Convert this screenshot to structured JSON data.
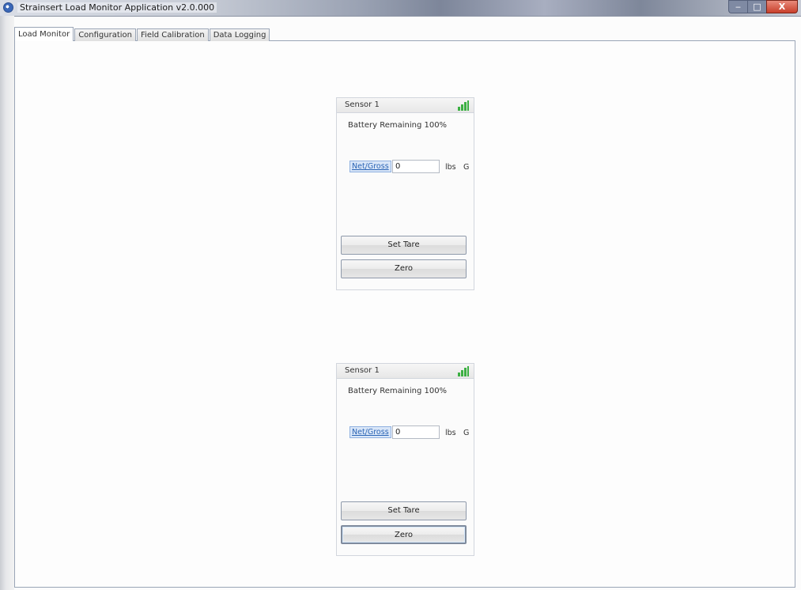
{
  "window": {
    "title": "Strainsert Load Monitor Application v2.0.000",
    "controls": {
      "minimize": "‒",
      "maximize": "□",
      "close": "X"
    }
  },
  "tabs": [
    {
      "label": "Load Monitor",
      "active": true
    },
    {
      "label": "Configuration",
      "active": false
    },
    {
      "label": "Field Calibration",
      "active": false
    },
    {
      "label": "Data Logging",
      "active": false
    }
  ],
  "sensors": [
    {
      "title": "Sensor 1",
      "battery": "Battery Remaining 100%",
      "netgross_label": "Net/Gross",
      "value": "0",
      "unit": "lbs",
      "mode": "G",
      "set_tare_label": "Set Tare",
      "zero_label": "Zero"
    },
    {
      "title": "Sensor 1",
      "battery": "Battery Remaining 100%",
      "netgross_label": "Net/Gross",
      "value": "0",
      "unit": "lbs",
      "mode": "G",
      "set_tare_label": "Set Tare",
      "zero_label": "Zero"
    }
  ],
  "colors": {
    "signal": "#3cb043",
    "link": "#2c65b5"
  }
}
